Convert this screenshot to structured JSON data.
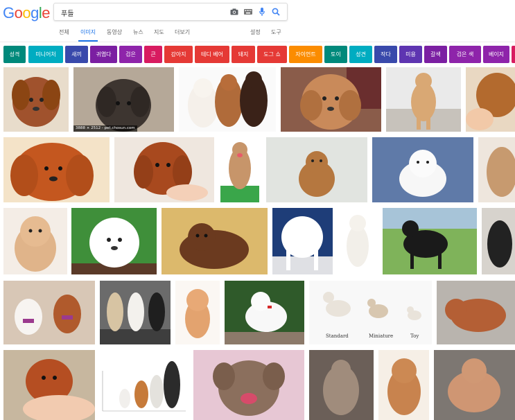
{
  "logo": {
    "letters": [
      "G",
      "o",
      "o",
      "g",
      "l",
      "e"
    ],
    "colors": [
      "#4285f4",
      "#ea4335",
      "#fbbc05",
      "#4285f4",
      "#34a853",
      "#ea4335"
    ]
  },
  "search": {
    "query": "푸들",
    "camera_icon": "camera-icon",
    "keyboard_icon": "keyboard-icon",
    "mic_icon": "microphone-icon",
    "search_icon": "search-icon"
  },
  "tabs": {
    "all": "전체",
    "images": "이미지",
    "videos": "동영상",
    "news": "뉴스",
    "maps": "지도",
    "more": "더보기",
    "settings": "설정",
    "tools": "도구"
  },
  "chips": [
    {
      "label": "성격",
      "color": "#00897b"
    },
    {
      "label": "미니어처",
      "color": "#00acc1"
    },
    {
      "label": "새끼",
      "color": "#3949ab"
    },
    {
      "label": "귀엽다",
      "color": "#7b1fa2"
    },
    {
      "label": "검은",
      "color": "#8e24aa"
    },
    {
      "label": "큰",
      "color": "#d81b60"
    },
    {
      "label": "강아지",
      "color": "#e53935"
    },
    {
      "label": "테디 베어",
      "color": "#e53935"
    },
    {
      "label": "돼지",
      "color": "#e53935"
    },
    {
      "label": "도그 쇼",
      "color": "#e53935"
    },
    {
      "label": "자이언트",
      "color": "#fb8c00"
    },
    {
      "label": "토이",
      "color": "#00897b"
    },
    {
      "label": "성견",
      "color": "#00acc1"
    },
    {
      "label": "작다",
      "color": "#3949ab"
    },
    {
      "label": "미용",
      "color": "#5e35b1"
    },
    {
      "label": "갈색",
      "color": "#7b1fa2"
    },
    {
      "label": "검은 색",
      "color": "#8e24aa"
    },
    {
      "label": "베이지",
      "color": "#8e24aa"
    },
    {
      "label": "",
      "color": "#d81b60"
    }
  ],
  "results": {
    "caption_2": "3888 × 2512 - pet.chosun.com",
    "chart_labels": {
      "standard": "Standard",
      "miniature": "Miniature",
      "toy": "Toy"
    }
  }
}
